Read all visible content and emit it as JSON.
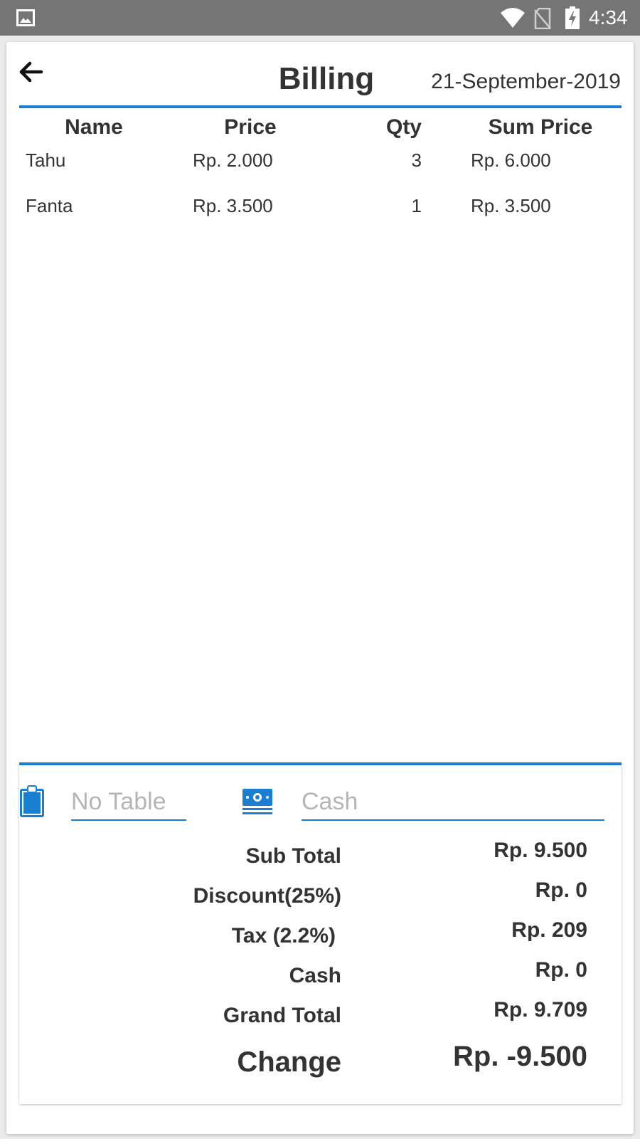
{
  "status_bar": {
    "time": "4:34",
    "icons": [
      "gallery-icon",
      "wifi-icon",
      "no-sim-icon",
      "battery-charging-icon"
    ]
  },
  "header": {
    "back_icon": "arrow-left-icon",
    "title": "Billing",
    "date": "21-September-2019"
  },
  "table": {
    "columns": [
      "Name",
      "Price",
      "Qty",
      "Sum Price"
    ],
    "rows": [
      {
        "name": "Tahu",
        "price": "Rp. 2.000",
        "qty": "3",
        "sum": "Rp. 6.000"
      },
      {
        "name": "Fanta",
        "price": "Rp. 3.500",
        "qty": "1",
        "sum": "Rp. 3.500"
      }
    ]
  },
  "inputs": {
    "table_icon": "clipboard-icon",
    "table_placeholder": "No Table",
    "table_value": "",
    "cash_icon": "money-icon",
    "cash_placeholder": "Cash",
    "cash_value": ""
  },
  "summary": {
    "sub_total_label": "Sub Total",
    "sub_total_value": "Rp. 9.500",
    "discount_label": "Discount(25%)",
    "discount_value": "Rp. 0",
    "tax_label": "Tax (2.2%)",
    "tax_value": "Rp. 209",
    "cash_label": "Cash",
    "cash_value": "Rp. 0",
    "grand_total_label": "Grand Total",
    "grand_total_value": "Rp. 9.709",
    "change_label": "Change",
    "change_value": "Rp. -9.500"
  },
  "colors": {
    "accent": "#1a7fd1",
    "status_bar": "#757575",
    "text": "#333333",
    "placeholder": "#b5b5b5"
  }
}
